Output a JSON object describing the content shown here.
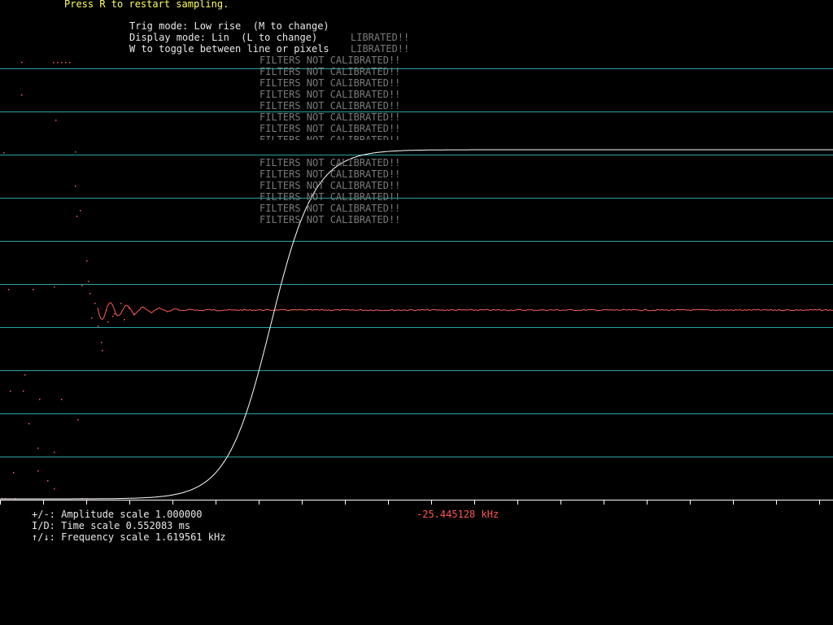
{
  "header": {
    "restart_hint": "Press R to restart sampling.",
    "trig_mode": "Trig mode: Low rise  (M to change)",
    "display_mode": "Display mode: Lin  (L to change)",
    "draw_toggle": "W to toggle between line or pixels"
  },
  "warnings": {
    "full": "FILTERS NOT CALIBRATED!!",
    "partial": "LIBRATED!!",
    "repeat_count": 14
  },
  "footer": {
    "amplitude": "+/-: Amplitude scale 1.000000",
    "time": "I/D: Time scale 0.552083 ms",
    "frequency": "↑/↓: Frequency scale 1.619561 kHz",
    "frequency_readout": "-25.445128 kHz"
  },
  "colors": {
    "background": "#000000",
    "grid": "#2aa3a3",
    "trace_step": "#ffffff",
    "trace_spectrum": "#ff5a5a",
    "header_text": "#ffff55",
    "warning_text": "#7a7a7a"
  }
}
